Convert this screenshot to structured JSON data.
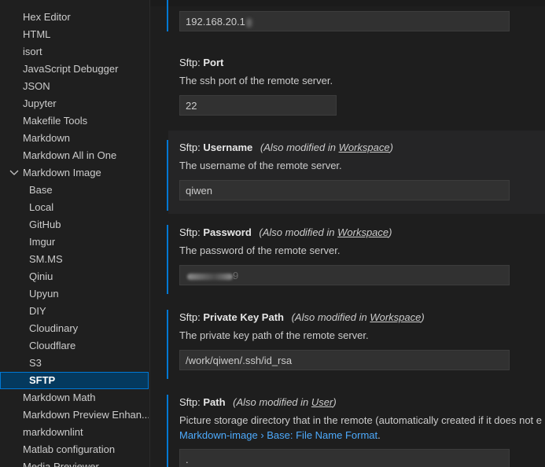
{
  "sidebar": {
    "items": [
      {
        "label": "Hex Editor"
      },
      {
        "label": "HTML"
      },
      {
        "label": "isort"
      },
      {
        "label": "JavaScript Debugger"
      },
      {
        "label": "JSON"
      },
      {
        "label": "Jupyter"
      },
      {
        "label": "Makefile Tools"
      },
      {
        "label": "Markdown"
      },
      {
        "label": "Markdown All in One"
      },
      {
        "label": "Markdown Image",
        "expanded": true
      },
      {
        "label": "Base"
      },
      {
        "label": "Local"
      },
      {
        "label": "GitHub"
      },
      {
        "label": "Imgur"
      },
      {
        "label": "SM.MS"
      },
      {
        "label": "Qiniu"
      },
      {
        "label": "Upyun"
      },
      {
        "label": "DIY"
      },
      {
        "label": "Cloudinary"
      },
      {
        "label": "Cloudflare"
      },
      {
        "label": "S3"
      },
      {
        "label": "SFTP",
        "selected": true
      },
      {
        "label": "Markdown Math"
      },
      {
        "label": "Markdown Preview Enhan..."
      },
      {
        "label": "markdownlint"
      },
      {
        "label": "Matlab configuration"
      },
      {
        "label": "Media Previewer"
      }
    ]
  },
  "settings": {
    "host": {
      "value": "192.168.20.1"
    },
    "port": {
      "category": "Sftp: ",
      "name": "Port",
      "description": "The ssh port of the remote server.",
      "value": "22"
    },
    "username": {
      "category": "Sftp: ",
      "name": "Username",
      "modified_prefix": "(Also modified in ",
      "modified_scope": "Workspace",
      "modified_suffix": ")",
      "description": "The username of the remote server.",
      "value": "qiwen"
    },
    "password": {
      "category": "Sftp: ",
      "name": "Password",
      "modified_prefix": "(Also modified in ",
      "modified_scope": "Workspace",
      "modified_suffix": ")",
      "description": "The password of the remote server.",
      "value": "9"
    },
    "private_key": {
      "category": "Sftp: ",
      "name": "Private Key Path",
      "modified_prefix": "(Also modified in ",
      "modified_scope": "Workspace",
      "modified_suffix": ")",
      "description": "The private key path of the remote server.",
      "value": "/work/qiwen/.ssh/id_rsa"
    },
    "path": {
      "category": "Sftp: ",
      "name": "Path",
      "modified_prefix": "(Also modified in ",
      "modified_scope": "User",
      "modified_suffix": ")",
      "description": "Picture storage directory that in the remote (automatically created if it does not e",
      "link_text": "Markdown-image › Base: File Name Format",
      "link_suffix": ".",
      "value": "."
    }
  },
  "colors": {
    "background": "#1e1e1e",
    "sidebar_selected": "#04395e",
    "focus_border": "#0078d4",
    "link": "#4daafc",
    "input_bg": "#313131"
  },
  "icons": {
    "expand": "chevron-down-icon"
  }
}
